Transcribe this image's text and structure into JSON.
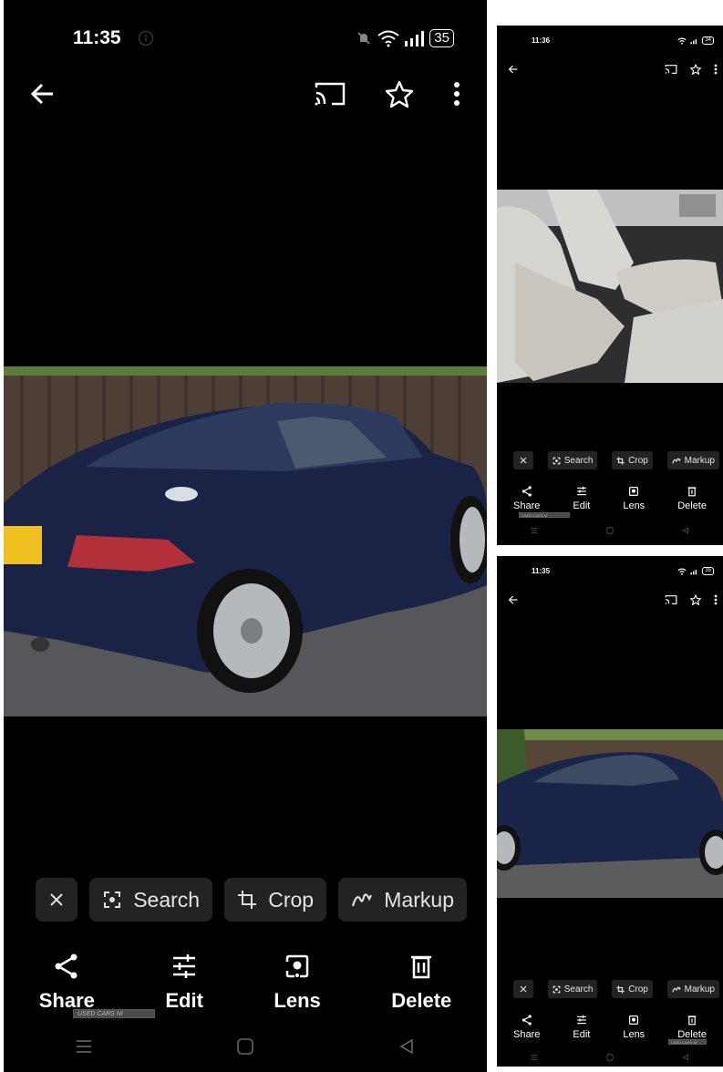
{
  "main": {
    "status": {
      "time": "11:35",
      "battery": "35"
    },
    "chips": {
      "search": "Search",
      "crop": "Crop",
      "markup": "Markup"
    },
    "actions": {
      "share": "Share",
      "edit": "Edit",
      "lens": "Lens",
      "delete": "Delete"
    },
    "watermark": "USED CARS NI"
  },
  "thumb_a": {
    "status": {
      "time": "11:36",
      "battery": "34"
    },
    "chips": {
      "search": "Search",
      "crop": "Crop",
      "markup": "Markup"
    },
    "actions": {
      "share": "Share",
      "edit": "Edit",
      "lens": "Lens",
      "delete": "Delete"
    },
    "watermark": "USED CARS NI"
  },
  "thumb_b": {
    "status": {
      "time": "11:35",
      "battery": "35"
    },
    "chips": {
      "search": "Search",
      "crop": "Crop",
      "markup": "Markup"
    },
    "actions": {
      "share": "Share",
      "edit": "Edit",
      "lens": "Lens",
      "delete": "Delete"
    },
    "watermark": "USED CARS NI"
  }
}
